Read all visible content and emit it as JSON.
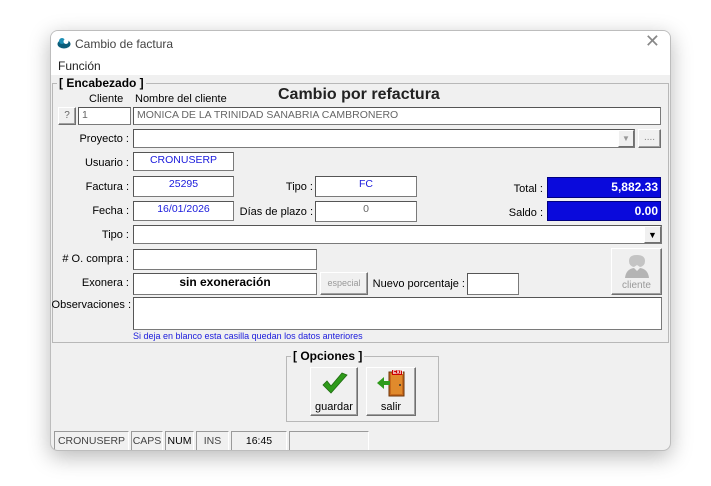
{
  "window": {
    "title": "Cambio de factura",
    "close_glyph": "✕"
  },
  "menu": {
    "funcion": "Función"
  },
  "encabezado": {
    "group_title": "[ Encabezado ]",
    "heading": "Cambio por refactura",
    "cliente_col_label": "Cliente",
    "nombre_col_label": "Nombre del cliente",
    "help_button": "?",
    "cliente_code": "1",
    "cliente_name": "MONICA DE LA TRINIDAD SANABRIA CAMBRONERO",
    "proyecto_label": "Proyecto :",
    "proyecto_value": "",
    "proyecto_more": "....",
    "usuario_label": "Usuario :",
    "usuario_value": "CRONUSERP",
    "factura_label": "Factura :",
    "factura_value": "25295",
    "tipo_doc_label": "Tipo :",
    "tipo_doc_value": "FC",
    "total_label": "Total :",
    "total_value": "5,882.33",
    "fecha_label": "Fecha :",
    "fecha_value": "16/01/2026",
    "dias_label": "Días de plazo :",
    "dias_value": "0",
    "saldo_label": "Saldo :",
    "saldo_value": "0.00",
    "tipo_label": "Tipo :",
    "tipo_value": "",
    "ocompra_label": "# O. compra :",
    "ocompra_value": "",
    "exonera_label": "Exonera :",
    "exonera_value": "sin exoneración",
    "especial_button": "especial",
    "nuevo_pct_label": "Nuevo porcentaje :",
    "nuevo_pct_value": "",
    "cliente_button": "cliente",
    "observaciones_label": "Observaciones :",
    "observaciones_value": "",
    "hint": "Si deja en blanco esta casilla quedan los datos anteriores"
  },
  "opciones": {
    "group_title": "[ Opciones ]",
    "guardar": "guardar",
    "salir": "salir",
    "exit_sign": "EXIT"
  },
  "status": {
    "user": "CRONUSERP",
    "caps": "CAPS",
    "num": "NUM",
    "ins": "INS",
    "time": "16:45",
    "extra": ""
  },
  "colors": {
    "total_bg": "#0a0adc",
    "field_text_blue": "#1a1adc",
    "check_green": "#2e9a1a"
  }
}
